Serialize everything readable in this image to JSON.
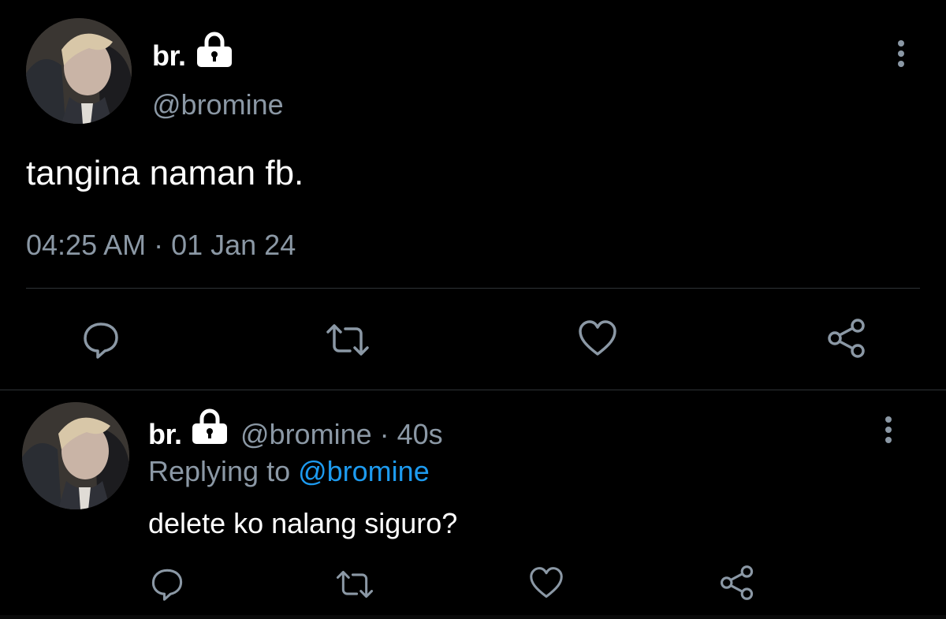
{
  "main_tweet": {
    "display_name": "br.",
    "handle": "@bromine",
    "text": "tangina naman fb.",
    "timestamp": "04:25 AM · 01 Jan 24",
    "protected_icon": "lock-icon",
    "actions": [
      "reply-icon",
      "retweet-icon",
      "like-icon",
      "share-icon"
    ]
  },
  "reply_tweet": {
    "display_name": "br.",
    "handle_time": "@bromine · 40s",
    "replying_prefix": "Replying to ",
    "replying_mention": "@bromine",
    "text": "delete ko nalang siguro?",
    "protected_icon": "lock-icon",
    "actions": [
      "reply-icon",
      "retweet-icon",
      "like-icon",
      "share-icon"
    ]
  },
  "colors": {
    "background": "#000000",
    "primary_text": "#ffffff",
    "secondary_text": "#8b98a5",
    "mention": "#1d9bf0",
    "divider": "#2f3336"
  }
}
